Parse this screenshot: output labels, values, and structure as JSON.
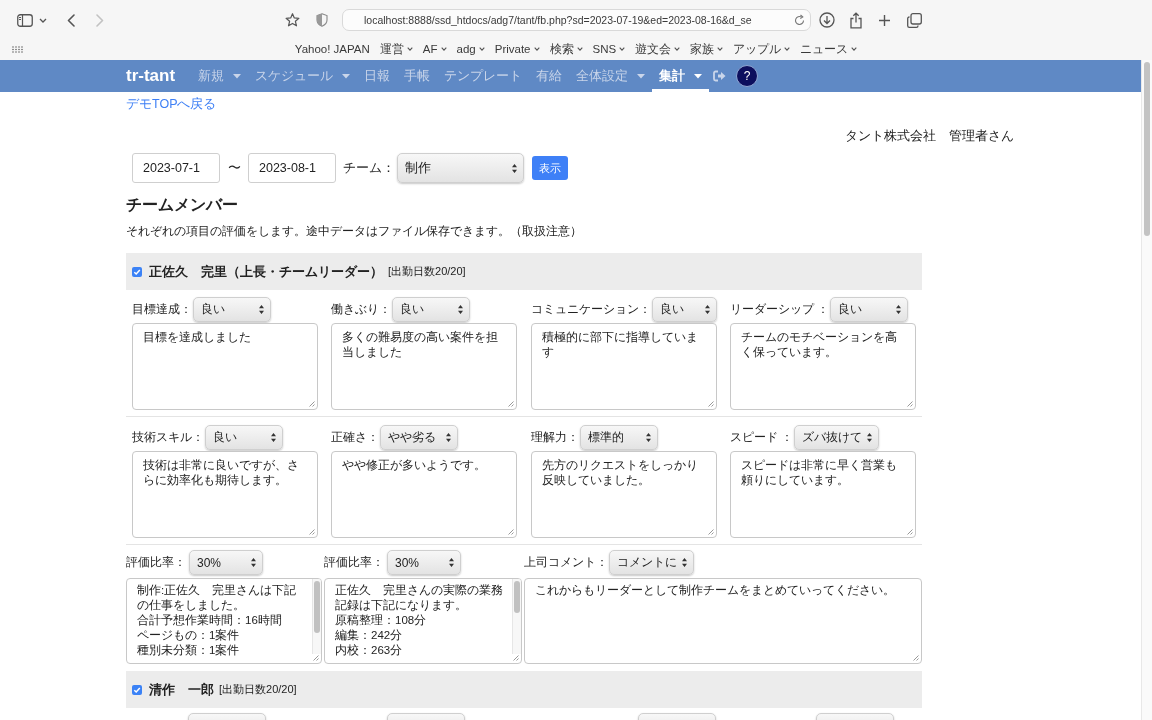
{
  "browser": {
    "nav_buttons": [
      {
        "kind": "back",
        "disabled": false
      },
      {
        "kind": "forward",
        "disabled": true
      }
    ],
    "url": "localhost:8888/ssd_htdocs/adg7/tant/fb.php?sd=2023-07-19&ed=2023-08-16&d_se",
    "bookmarks": [
      {
        "label": "Yahoo! JAPAN",
        "dropdown": false
      },
      {
        "label": "運営",
        "dropdown": true
      },
      {
        "label": "AF",
        "dropdown": true
      },
      {
        "label": "adg",
        "dropdown": true
      },
      {
        "label": "Private",
        "dropdown": true
      },
      {
        "label": "検索",
        "dropdown": true
      },
      {
        "label": "SNS",
        "dropdown": true
      },
      {
        "label": "遊文会",
        "dropdown": true
      },
      {
        "label": "家族",
        "dropdown": true
      },
      {
        "label": "アップル",
        "dropdown": true
      },
      {
        "label": "ニュース",
        "dropdown": true
      }
    ]
  },
  "navbar": {
    "brand": "tr-tant",
    "items": [
      {
        "label": "新規",
        "dropdown": true,
        "selected": false
      },
      {
        "label": "スケジュール",
        "dropdown": true,
        "selected": false
      },
      {
        "label": "日報",
        "dropdown": false,
        "selected": false
      },
      {
        "label": "手帳",
        "dropdown": false,
        "selected": false
      },
      {
        "label": "テンプレート",
        "dropdown": false,
        "selected": false
      },
      {
        "label": "有給",
        "dropdown": false,
        "selected": false
      },
      {
        "label": "全体設定",
        "dropdown": true,
        "selected": false
      },
      {
        "label": "集計",
        "dropdown": true,
        "selected": true
      }
    ],
    "help": "?"
  },
  "back_link": "デモTOPへ戻る",
  "user_info": "タント株式会社　管理者さん",
  "filter": {
    "start_date": "2023-07-1",
    "separator": "〜",
    "end_date": "2023-08-1",
    "team_label": "チーム：",
    "team": "制作",
    "submit": "表示"
  },
  "heading": "チームメンバー",
  "description": "それぞれの項目の評価をします。途中データはファイル保存できます。（取扱注意）",
  "members": [
    {
      "checked": true,
      "name": "正佐久　完里（上長・チームリーダー）",
      "attendance": "[出勤日数20/20]",
      "criteria_rows": [
        [
          {
            "label": "目標達成：",
            "value": "良い",
            "comment": "目標を達成しました"
          },
          {
            "label": "働きぶり：",
            "value": "良い",
            "comment": "多くの難易度の高い案件を担当しました"
          },
          {
            "label": "コミュニケーション：",
            "value": "良い",
            "comment": "積極的に部下に指導しています"
          },
          {
            "label": "リーダーシップ ：",
            "value": "良い",
            "comment": "チームのモチベーションを高く保っています。"
          }
        ],
        [
          {
            "label": "技術スキル：",
            "value": "良い",
            "comment": "技術は非常に良いですが、さらに効率化も期待します。"
          },
          {
            "label": "正確さ：",
            "value": "やや劣る",
            "comment": "やや修正が多いようです。"
          },
          {
            "label": "理解力：",
            "value": "標準的",
            "comment": "先方のリクエストをしっかり反映していました。"
          },
          {
            "label": "スピード ：",
            "value": "ズバ抜けて",
            "comment": "スピードは非常に早く営業も頼りにしています。"
          }
        ]
      ],
      "ratios": [
        {
          "label": "評価比率：",
          "value": "30%",
          "note_lines": [
            "制作:正佐久　完里さんは下記の仕事をしました。",
            "合計予想作業時間：16時間",
            "ページもの：1案件",
            "種別未分類：1案件"
          ]
        },
        {
          "label": "評価比率：",
          "value": "30%",
          "note_lines": [
            "正佐久　完里さんの実際の業務記録は下記になります。",
            "原稿整理：108分",
            "編集：242分",
            "内校：263分"
          ]
        }
      ],
      "boss_comment": {
        "label": "上司コメント：",
        "value": "コメントに",
        "comment": "これからもリーダーとして制作チームをまとめていってください。"
      }
    },
    {
      "checked": true,
      "name": "清作　一郎",
      "attendance": "[出勤日数20/20]",
      "next_row": [
        {
          "kind": "select"
        },
        {
          "kind": "select"
        },
        {
          "kind": "select"
        },
        {
          "kind": "select"
        }
      ]
    }
  ]
}
